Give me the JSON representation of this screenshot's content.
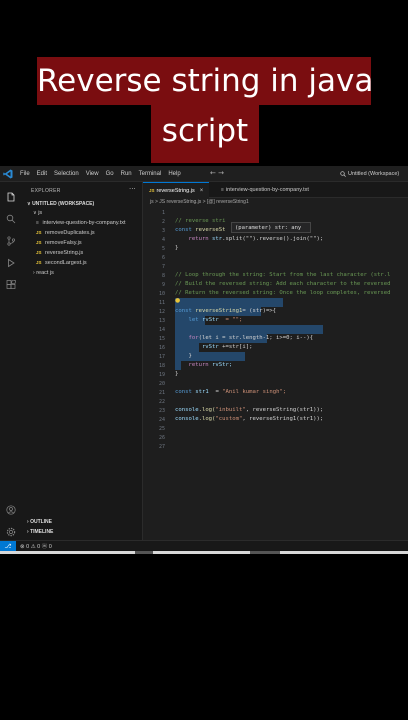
{
  "caption": {
    "line1": "Reverse string in java",
    "line2": "script"
  },
  "titlebar": {
    "menu": [
      "File",
      "Edit",
      "Selection",
      "View",
      "Go",
      "Run",
      "Terminal",
      "Help"
    ],
    "nav": "← →",
    "command_center": "Untitled (Workspace)"
  },
  "sidebar": {
    "title": "EXPLORER",
    "more": "···",
    "workspace": "UNTITLED (WORKSPACE)",
    "folder_js": "js",
    "files": [
      {
        "name": "interview-question-by-company.txt",
        "kind": "txt"
      },
      {
        "name": "removeDuplicates.js",
        "kind": "js"
      },
      {
        "name": "removeFalsy.js",
        "kind": "js"
      },
      {
        "name": "reverseString.js",
        "kind": "js"
      },
      {
        "name": "secondLargest.js",
        "kind": "js"
      }
    ],
    "folder_react": "react js",
    "outline": "OUTLINE",
    "timeline": "TIMELINE",
    "badge_js": "JS"
  },
  "tabs": [
    {
      "label": "reverseString.js",
      "close": "×"
    },
    {
      "label": "interview-question-by-company.txt"
    }
  ],
  "breadcrumb": "js > JS reverseString.js > [@] reverseString1",
  "tooltip": "(parameter) str: any",
  "editor": {
    "line_numbers": [
      "1",
      "2",
      "3",
      "4",
      "5",
      "6",
      "7",
      "8",
      "9",
      "10",
      "11",
      "12",
      "13",
      "14",
      "15",
      "16",
      "17",
      "18",
      "19",
      "20",
      "21",
      "22",
      "23",
      "24",
      "25",
      "26",
      "27"
    ],
    "lines": {
      "l2": "// reverse stri",
      "l3a": "const ",
      "l3b": "reverseSt",
      "l4a": "    return ",
      "l4b": "str",
      "l4c": ".split(\"\").reverse().join(\"\");",
      "l5": "}",
      "l8": "// Loop through the string: Start from the last character (str.l",
      "l9": "// Build the reversed string: Add each character to the reversed",
      "l10": "// Return the reversed string: Once the loop completes, reversed",
      "l12a": "const ",
      "l12b": "reverseString1",
      "l12c": "= (str)=>{",
      "l13a": "    let ",
      "l13b": "rvStr",
      "l13c": "  = \"\";",
      "l15a": "    for",
      "l15b": "(let i = str.length-1; i>=0; i--){",
      "l16a": "        rvStr",
      "l16b": " +=str[i];",
      "l17": "    }",
      "l18a": "    return ",
      "l18b": "rvStr;",
      "l19": "}",
      "l21a": "const ",
      "l21b": "str1",
      "l21c": "  = ",
      "l21d": "\"Anil kumar singh\";",
      "l23a": "console",
      "l23b": ".log(",
      "l23c": "\"inbuilt\"",
      "l23d": ", reverseString(str1));",
      "l24a": "console",
      "l24b": ".log(",
      "l24c": "\"custom\"",
      "l24d": ", reverseString1(str1));"
    }
  },
  "statusbar": {
    "remote": "⎇",
    "text": "⊗ 0 ⚠ 0    ⓦ 0"
  },
  "colors": {
    "accent": "#0078d4",
    "caption_bg": "#7a0d10",
    "editor_bg": "#1e1e1e",
    "selection": "#264f78"
  }
}
